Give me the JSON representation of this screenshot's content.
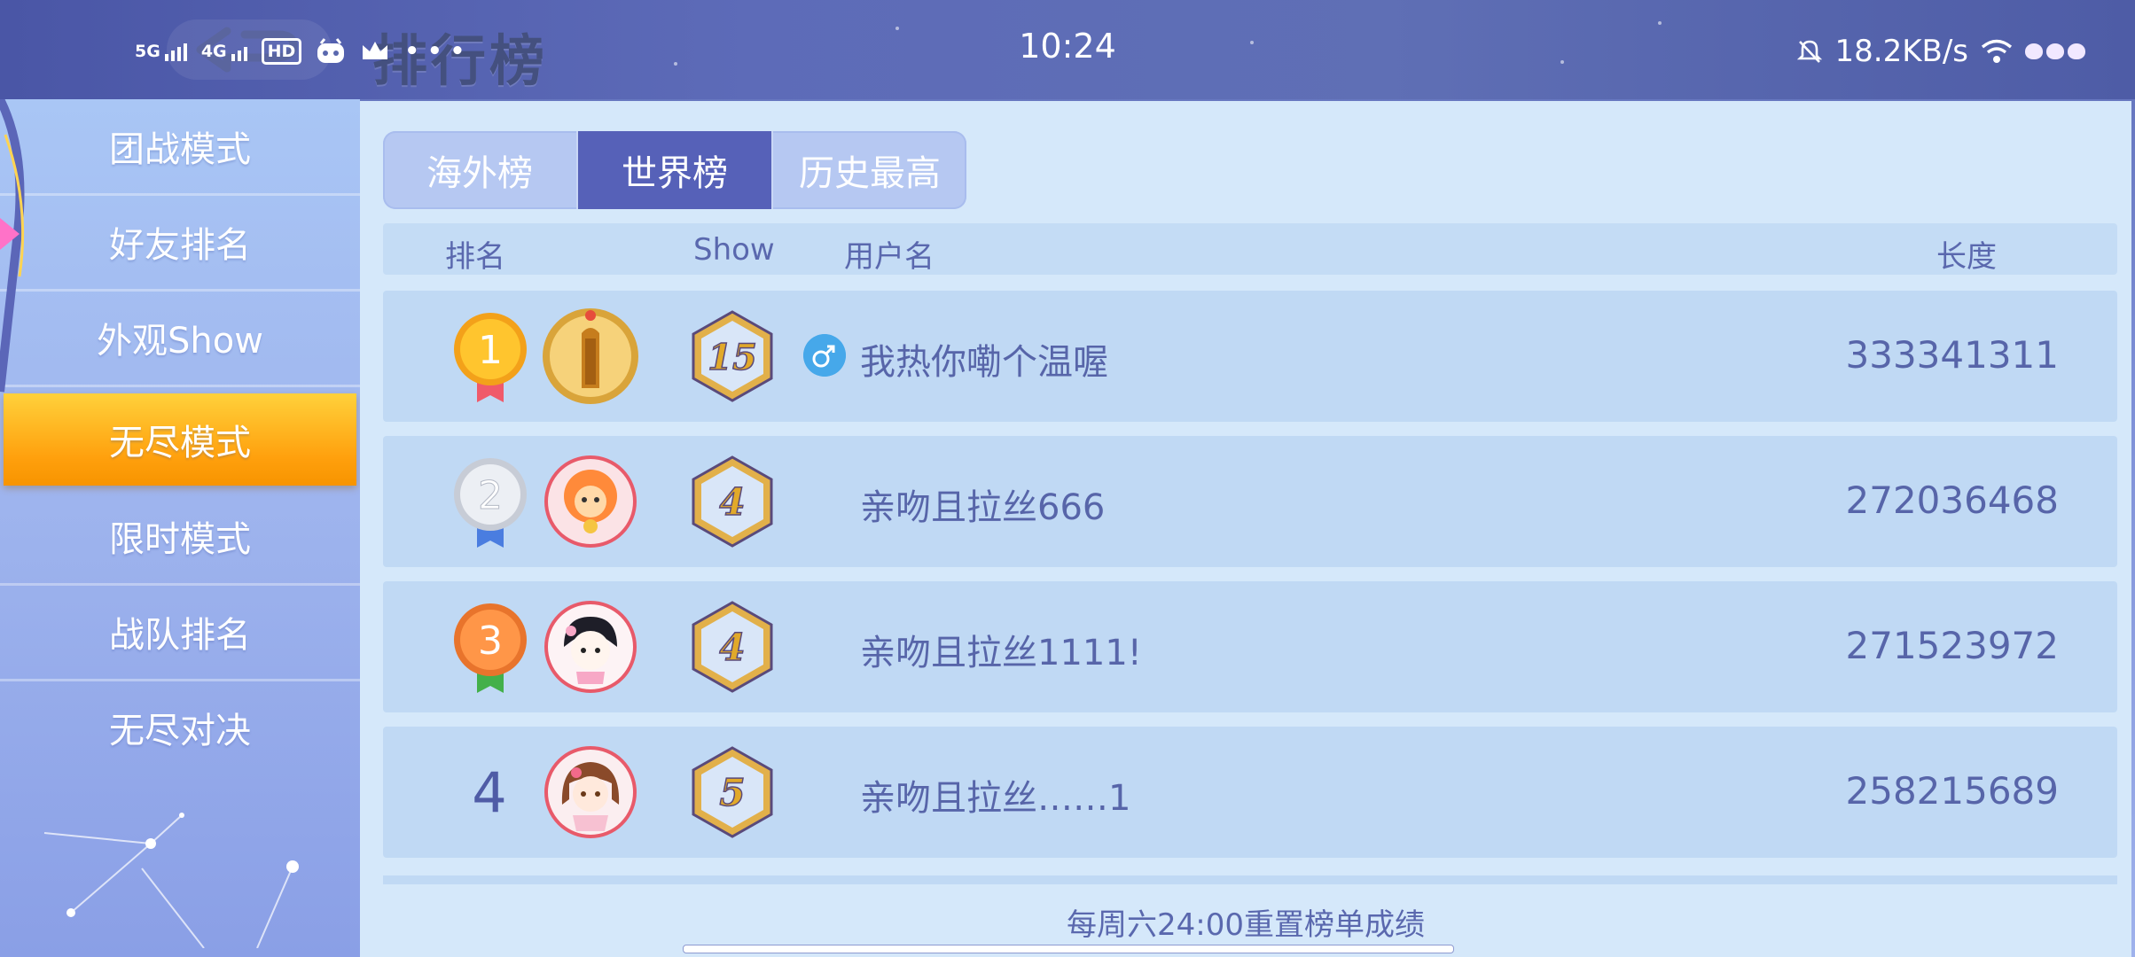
{
  "status_bar": {
    "network_1": "5G",
    "network_2": "4G",
    "hd_badge": "HD",
    "time": "10:24",
    "speed": "18.2KB/s"
  },
  "header": {
    "title": "排行榜"
  },
  "sidebar": {
    "items": [
      {
        "label": "团战模式",
        "active": false
      },
      {
        "label": "好友排名",
        "active": false
      },
      {
        "label": "外观Show",
        "active": false
      },
      {
        "label": "无尽模式",
        "active": true
      },
      {
        "label": "限时模式",
        "active": false
      },
      {
        "label": "战队排名",
        "active": false
      },
      {
        "label": "无尽对决",
        "active": false
      }
    ]
  },
  "tabs": [
    {
      "label": "海外榜",
      "active": false
    },
    {
      "label": "世界榜",
      "active": true
    },
    {
      "label": "历史最高",
      "active": false
    }
  ],
  "columns": {
    "rank": "排名",
    "show": "Show",
    "username": "用户名",
    "length": "长度"
  },
  "rows": [
    {
      "rank": "1",
      "show": "15",
      "username": "我热你嘞个温喔",
      "length": "333341311",
      "gender": "male"
    },
    {
      "rank": "2",
      "show": "4",
      "username": "亲吻且拉丝666",
      "length": "272036468"
    },
    {
      "rank": "3",
      "show": "4",
      "username": "亲吻且拉丝1111!",
      "length": "271523972"
    },
    {
      "rank": "4",
      "show": "5",
      "username": "亲吻且拉丝……1",
      "length": "258215689"
    }
  ],
  "footer": {
    "note": "每周六24:00重置榜单成绩"
  },
  "colors": {
    "accent": "#5661b8",
    "active_sidebar": "#ffa00d",
    "gold": "#f7b21e",
    "silver": "#d8dde6",
    "bronze": "#f08a3c"
  }
}
